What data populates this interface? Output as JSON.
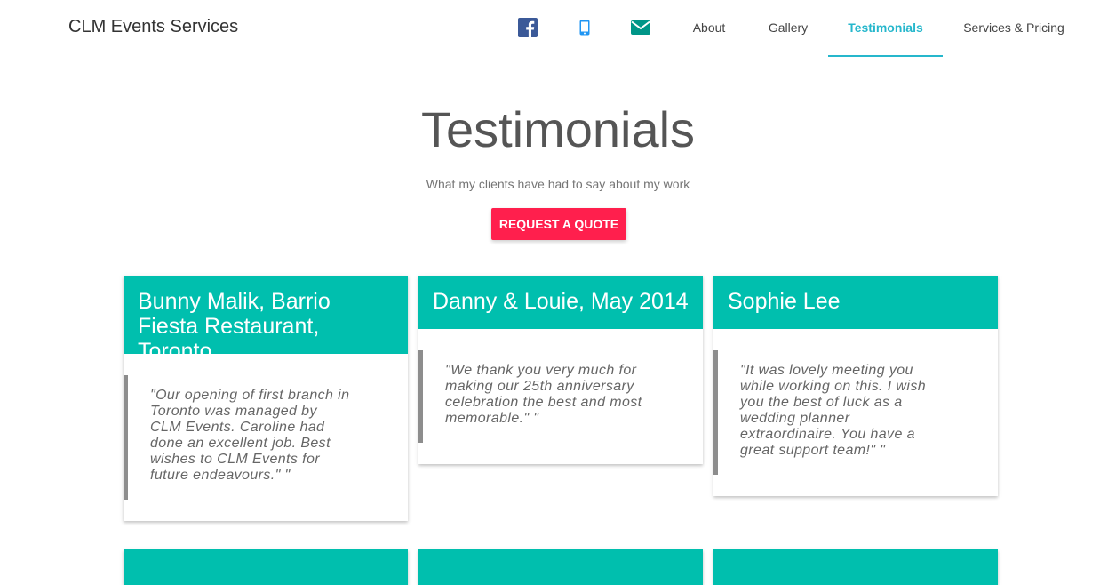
{
  "navbar": {
    "brand": "CLM Events Services",
    "icons": [
      "facebook-icon",
      "phone-icon",
      "mail-icon"
    ],
    "links": [
      {
        "label": "About",
        "active": false
      },
      {
        "label": "Gallery",
        "active": false
      },
      {
        "label": "Testimonials",
        "active": true
      },
      {
        "label": "Services & Pricing",
        "active": false
      }
    ]
  },
  "hero": {
    "title": "Testimonials",
    "subtitle": "What my clients have had to say about my work",
    "button_label": "REQUEST A QUOTE"
  },
  "testimonials": [
    {
      "name": "Bunny Malik, Barrio Fiesta Restaurant, Toronto",
      "quote": "\"Our opening of first branch in Toronto was managed by CLM Events. Caroline had done an excellent job. Best wishes to CLM Events for future endeavours.\" \""
    },
    {
      "name": "Danny & Louie, May 2014",
      "quote": "\"We thank you very much for making our 25th anniversary celebration the best and most memorable.\" \""
    },
    {
      "name": "Sophie Lee",
      "quote": "\"It was lovely meeting you while working on this. I wish you the best of luck as a wedding planner extraordinaire. You have a great support team!\" \""
    }
  ],
  "colors": {
    "accent": "#00bfae",
    "nav_active": "#26b7cc",
    "button": "#ff1f4d",
    "facebook": "#3b5998",
    "phone": "#2196f3",
    "mail": "#009688"
  }
}
